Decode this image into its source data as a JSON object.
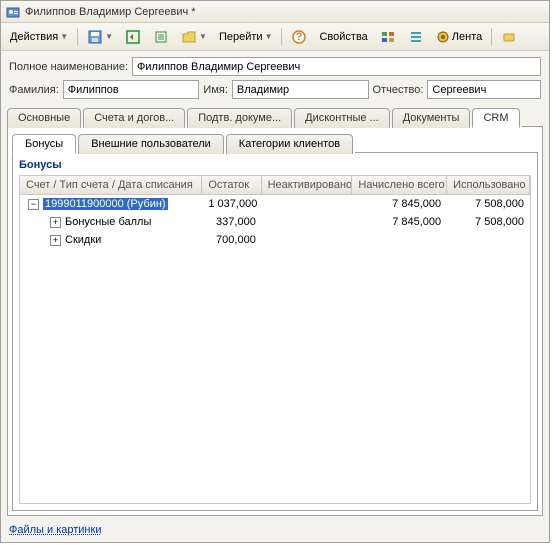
{
  "title": "Филиппов Владимир Сергеевич *",
  "toolbar": {
    "actions": "Действия",
    "goto": "Перейти",
    "properties": "Свойства",
    "feed": "Лента"
  },
  "form": {
    "full_name_label": "Полное наименование:",
    "full_name": "Филиппов Владимир Сергеевич",
    "lastname_label": "Фамилия:",
    "lastname": "Филиппов",
    "firstname_label": "Имя:",
    "firstname": "Владимир",
    "middlename_label": "Отчество:",
    "middlename": "Сергеевич"
  },
  "tabs": {
    "t1": "Основные",
    "t2": "Счета и догов...",
    "t3": "Подтв. докуме...",
    "t4": "Дисконтные ...",
    "t5": "Документы",
    "t6": "CRM"
  },
  "inner_tabs": {
    "i1": "Бонусы",
    "i2": "Внешние пользователи",
    "i3": "Категории клиентов"
  },
  "section": "Бонусы",
  "grid": {
    "h0": "Счет / Тип счета / Дата списания",
    "h1": "Остаток",
    "h2": "Неактивировано",
    "h3": "Начислено всего",
    "h4": "Использовано",
    "rows": [
      {
        "name": "1999011900000 (Рубин)",
        "balance": "1 037,000",
        "inactive": "",
        "accrued": "7 845,000",
        "used": "7 508,000",
        "indent": 0,
        "exp": "−",
        "sel": true
      },
      {
        "name": "Бонусные баллы",
        "balance": "337,000",
        "inactive": "",
        "accrued": "7 845,000",
        "used": "7 508,000",
        "indent": 1,
        "exp": "+",
        "sel": false
      },
      {
        "name": "Скидки",
        "balance": "700,000",
        "inactive": "",
        "accrued": "",
        "used": "",
        "indent": 1,
        "exp": "+",
        "sel": false
      }
    ]
  },
  "footer_link": "Файлы и картинки"
}
